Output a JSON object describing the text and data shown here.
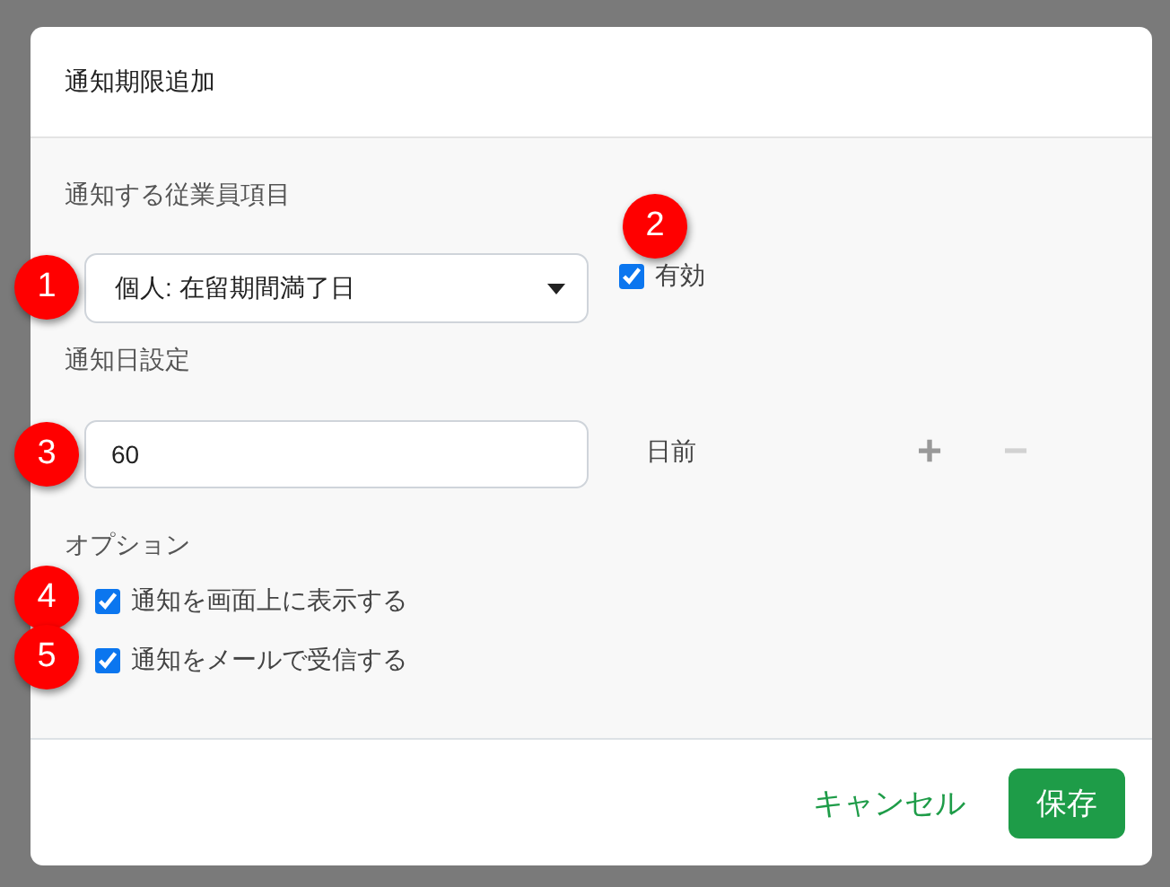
{
  "dialog": {
    "title": "通知期限追加"
  },
  "employee_item": {
    "label": "通知する従業員項目",
    "select_value": "個人: 在留期間満了日",
    "enabled": {
      "label": "有効",
      "checked": true
    }
  },
  "notify_days": {
    "label": "通知日設定",
    "value": "60",
    "unit": "日前",
    "add_button": {
      "label": "+",
      "disabled": false
    },
    "remove_button": {
      "label": "−",
      "disabled": true
    }
  },
  "options": {
    "label": "オプション",
    "items": [
      {
        "label": "通知を画面上に表示する",
        "checked": true
      },
      {
        "label": "通知をメールで受信する",
        "checked": true
      }
    ]
  },
  "footer": {
    "cancel": "キャンセル",
    "save": "保存"
  },
  "markers": [
    "1",
    "2",
    "3",
    "4",
    "5"
  ]
}
